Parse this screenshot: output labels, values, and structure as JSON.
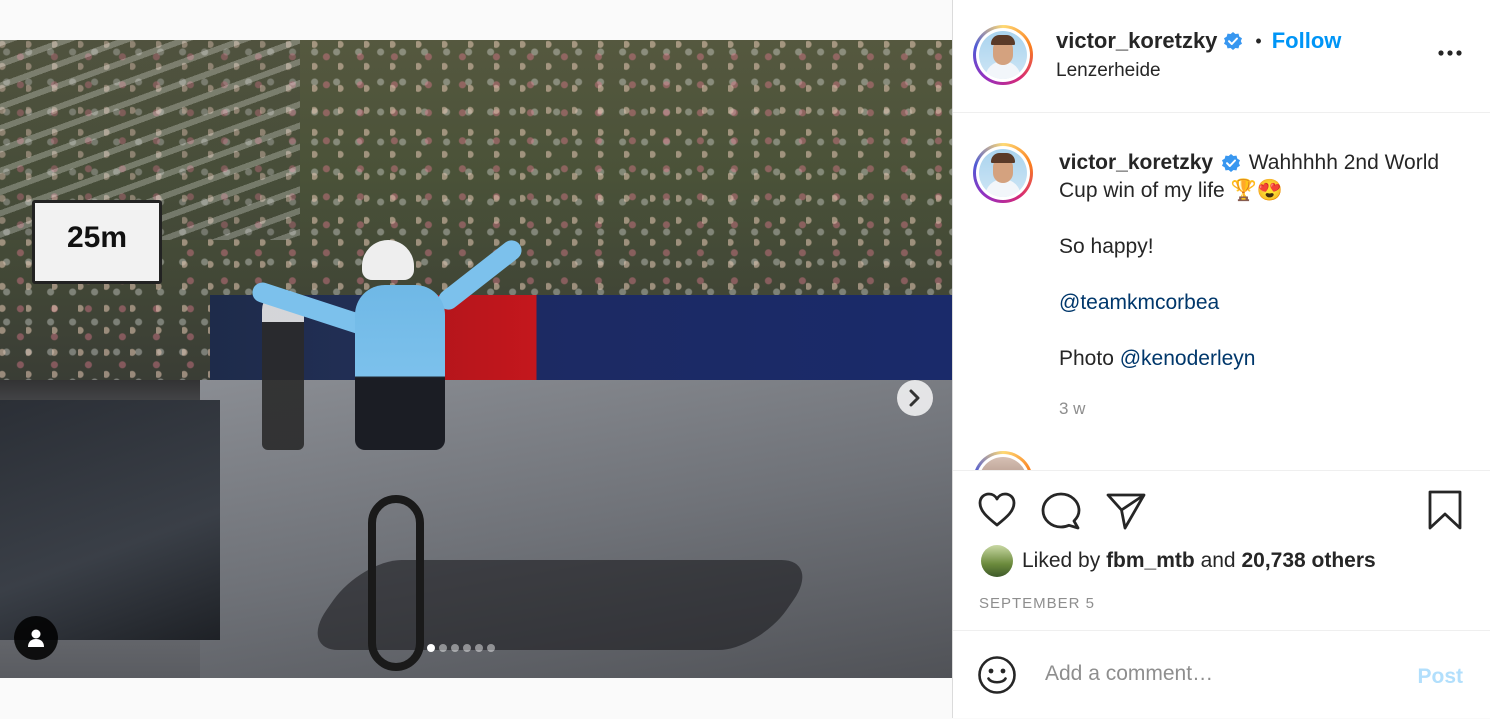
{
  "post": {
    "photo": {
      "sign_text": "25m",
      "carousel_dots": 6,
      "active_dot": 1,
      "next_icon": "chevron-right-icon",
      "tag_icon": "user-icon"
    }
  },
  "header": {
    "username": "victor_koretzky",
    "verified": true,
    "separator": "•",
    "follow_label": "Follow",
    "location": "Lenzerheide",
    "more_icon": "more-horizontal-icon"
  },
  "caption": {
    "username": "victor_koretzky",
    "text": "Wahhhhh 2nd World Cup win of my life 🏆😍",
    "line2": "So happy!",
    "mention1": "@teamkmcorbea",
    "photo_label": "Photo",
    "mention2": "@kenoderleyn",
    "time": "3 w"
  },
  "actions": {
    "like_icon": "heart-icon",
    "comment_icon": "comment-icon",
    "share_icon": "paper-plane-icon",
    "save_icon": "bookmark-icon",
    "liked_by_prefix": "Liked by",
    "liked_by_user": "fbm_mtb",
    "liked_by_and": "and",
    "liked_by_others": "20,738 others",
    "date": "SEPTEMBER 5"
  },
  "comment": {
    "emoji_icon": "smiley-icon",
    "placeholder": "Add a comment…",
    "post_label": "Post"
  },
  "colors": {
    "link_blue": "#0095f6",
    "mention_blue": "#00376b",
    "post_disabled": "#b2dffc",
    "muted": "#8e8e8e"
  }
}
